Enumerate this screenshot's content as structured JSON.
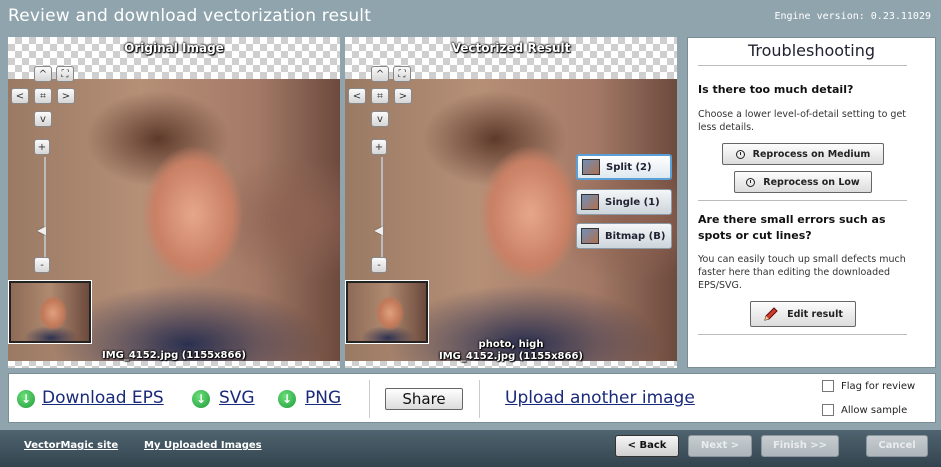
{
  "header": {
    "title": "Review and download vectorization result",
    "engine_version": "Engine version: 0.23.11029"
  },
  "viewers": {
    "original": {
      "title": "Original Image",
      "caption": "IMG_4152.jpg (1155x866)"
    },
    "vector": {
      "title": "Vectorized Result",
      "caption_line1": "photo, high",
      "caption_line2": "IMG_4152.jpg (1155x866)"
    },
    "nav": {
      "up": "^",
      "down": "v",
      "left": "<",
      "right": ">",
      "center": "⌗",
      "fit": "⛶",
      "zoom_in": "+",
      "zoom_out": "-"
    }
  },
  "view_modes": [
    {
      "label": "Split (2)",
      "active": true
    },
    {
      "label": "Single (1)",
      "active": false
    },
    {
      "label": "Bitmap (B)",
      "active": false
    }
  ],
  "troubleshooting": {
    "title": "Troubleshooting",
    "q1": "Is there too much detail?",
    "p1": "Choose a lower level-of-detail setting to get less details.",
    "btn_medium": "Reprocess on Medium",
    "btn_low": "Reprocess on Low",
    "q2": "Are there small errors such as spots or cut lines?",
    "p2": "You can easily touch up small defects much faster here than editing the downloaded EPS/SVG.",
    "btn_edit": "Edit result"
  },
  "toolbar": {
    "download_eps": "Download EPS",
    "svg": "SVG",
    "png": "PNG",
    "share": "Share",
    "upload_another": "Upload another image",
    "flag_for_review": "Flag for review",
    "allow_sample": "Allow sample"
  },
  "footer": {
    "vectormagic_site": "VectorMagic site",
    "my_uploaded_images": "My Uploaded Images",
    "back": "< Back",
    "next": "Next >",
    "finish": "Finish >>",
    "cancel": "Cancel"
  }
}
